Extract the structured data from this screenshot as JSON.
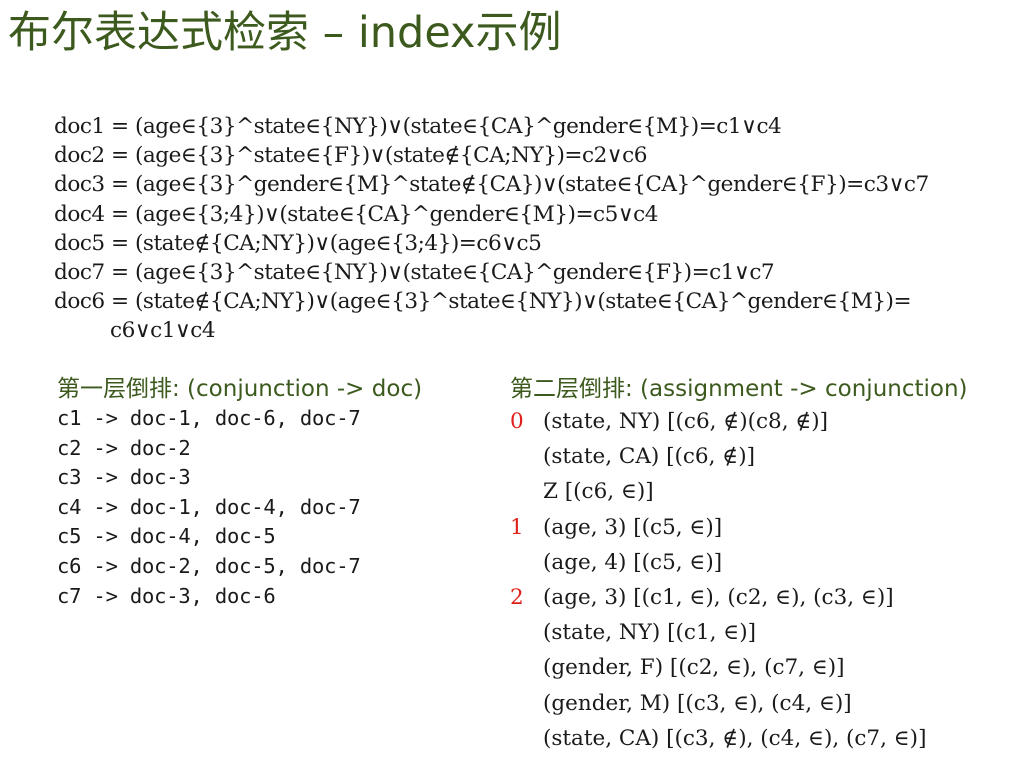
{
  "title": "布尔表达式检索 – index示例",
  "docs": [
    "doc1 = (age∈{3}^state∈{NY})∨(state∈{CA}^gender∈{M})=c1∨c4",
    "doc2 = (age∈{3}^state∈{F})∨(state∉{CA;NY})=c2∨c6",
    "doc3 = (age∈{3}^gender∈{M}^state∉{CA})∨(state∈{CA}^gender∈{F})=c3∨c7",
    "doc4 = (age∈{3;4})∨(state∈{CA}^gender∈{M})=c5∨c4",
    "doc5 = (state∉{CA;NY})∨(age∈{3;4})=c6∨c5",
    "doc7 = (age∈{3}^state∈{NY})∨(state∈{CA}^gender∈{F})=c1∨c7",
    "doc6 = (state∉{CA;NY})∨(age∈{3}^state∈{NY})∨(state∈{CA}^gender∈{M})=",
    "c6∨c1∨c4"
  ],
  "left": {
    "heading": "第一层倒排: (conjunction -> doc)",
    "items": [
      "c1 -> doc-1, doc-6, doc-7",
      "c2 -> doc-2",
      "c3 -> doc-3",
      "c4 -> doc-1, doc-4, doc-7",
      "c5 -> doc-4, doc-5",
      "c6 -> doc-2, doc-5, doc-7",
      "c7 -> doc-3, doc-6"
    ]
  },
  "right": {
    "heading": "第二层倒排: (assignment -> conjunction)",
    "rows": [
      {
        "key": "0",
        "text": "(state, NY) [(c6, ∉)(c8, ∉)]"
      },
      {
        "key": "",
        "text": "(state, CA) [(c6, ∉)]"
      },
      {
        "key": "",
        "text": "Z [(c6, ∈)]"
      },
      {
        "key": "1",
        "text": "(age, 3) [(c5, ∈)]"
      },
      {
        "key": "",
        "text": "(age, 4) [(c5, ∈)]"
      },
      {
        "key": "2",
        "text": "(age, 3) [(c1, ∈), (c2, ∈), (c3, ∈)]"
      },
      {
        "key": "",
        "text": "(state, NY) [(c1, ∈)]"
      },
      {
        "key": "",
        "text": "(gender, F) [(c2, ∈), (c7, ∈)]"
      },
      {
        "key": "",
        "text": "(gender, M) [(c3, ∈), (c4, ∈)]"
      },
      {
        "key": "",
        "text": "(state, CA) [(c3, ∉), (c4, ∈), (c7, ∈)]"
      }
    ]
  },
  "colors": {
    "heading": "#3d5a1e",
    "key": "#e0201b",
    "text": "#1a1a1a"
  }
}
